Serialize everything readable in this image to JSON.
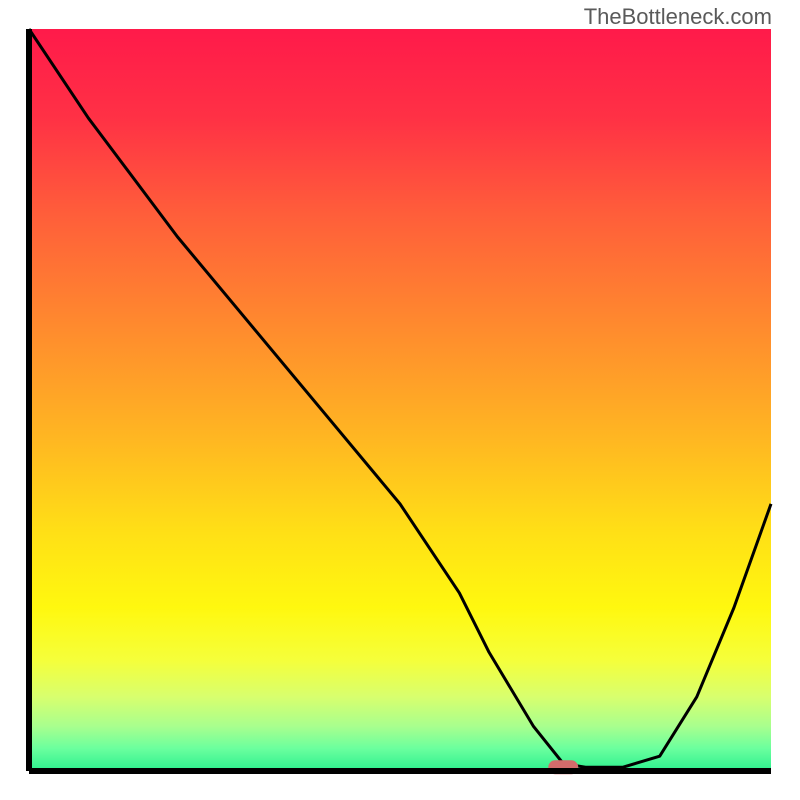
{
  "watermark": "TheBottleneck.com",
  "chart_data": {
    "type": "line",
    "title": "",
    "xlabel": "",
    "ylabel": "",
    "xlim": [
      0,
      100
    ],
    "ylim": [
      0,
      100
    ],
    "series": [
      {
        "name": "curve",
        "x": [
          0,
          8,
          20,
          30,
          40,
          50,
          58,
          62,
          68,
          72,
          75,
          80,
          85,
          90,
          95,
          100
        ],
        "y": [
          100,
          88,
          72,
          60,
          48,
          36,
          24,
          16,
          6,
          1,
          0.5,
          0.5,
          2,
          10,
          22,
          36
        ]
      }
    ],
    "marker": {
      "x": 72,
      "y": 0.5,
      "color": "#d26b6b"
    },
    "gradient_stops": [
      {
        "offset": 0,
        "color": "#ff1a4a"
      },
      {
        "offset": 12,
        "color": "#ff3145"
      },
      {
        "offset": 25,
        "color": "#ff5e3a"
      },
      {
        "offset": 40,
        "color": "#ff8a2e"
      },
      {
        "offset": 55,
        "color": "#ffb622"
      },
      {
        "offset": 68,
        "color": "#ffe016"
      },
      {
        "offset": 78,
        "color": "#fff80f"
      },
      {
        "offset": 85,
        "color": "#f5ff3a"
      },
      {
        "offset": 90,
        "color": "#d8ff6e"
      },
      {
        "offset": 94,
        "color": "#a8ff8e"
      },
      {
        "offset": 97,
        "color": "#6aff9e"
      },
      {
        "offset": 100,
        "color": "#2cf08e"
      }
    ],
    "axis_color": "#000000",
    "curve_color": "#000000"
  }
}
